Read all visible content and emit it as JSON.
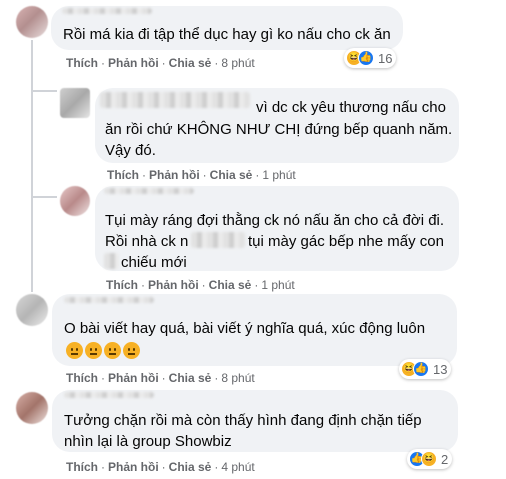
{
  "actions": {
    "like": "Thích",
    "reply": "Phản hồi",
    "share": "Chia sẻ",
    "sep": "·"
  },
  "comments": [
    {
      "lines": [
        "Rồi má kia đi tập thể dục hay gì ko nấu cho ck ăn"
      ],
      "time": "8 phút",
      "reaction_count": "16",
      "reactions": [
        "haha-icon",
        "like-icon"
      ]
    },
    {
      "lines": [
        "vì dc ck yêu thương nấu cho",
        "ăn rồi chứ KHÔNG NHƯ CHỊ đứng bếp quanh năm.",
        "Vậy đó."
      ],
      "time": "1 phút"
    },
    {
      "lines": [
        "Tụi mày ráng đợi thằng ck nó nấu ăn cho cả đời đi.",
        "Rồi nhà ck n",
        "tụi mày gác bếp nhe mấy con",
        "chiếu mới"
      ],
      "time": "1 phút"
    },
    {
      "lines": [
        "O bài viết hay quá, bài viết ý nghĩa quá, xúc động luôn"
      ],
      "emoji": [
        "confused-face-emoji",
        "confused-face-emoji",
        "confused-face-emoji",
        "confused-face-emoji"
      ],
      "time": "8 phút",
      "reaction_count": "13",
      "reactions": [
        "haha-icon",
        "like-icon"
      ]
    },
    {
      "lines": [
        "Tưởng chặn rồi mà còn thấy hình đang định chặn tiếp",
        "nhìn lại là group Showbiz"
      ],
      "time": "4 phút",
      "reaction_count": "2",
      "reactions": [
        "like-icon",
        "haha-icon"
      ]
    }
  ],
  "colors": {
    "bubble": "#f0f2f5",
    "meta": "#65676b",
    "like_blue": "#1877f2",
    "haha_yellow": "#f7b125"
  }
}
